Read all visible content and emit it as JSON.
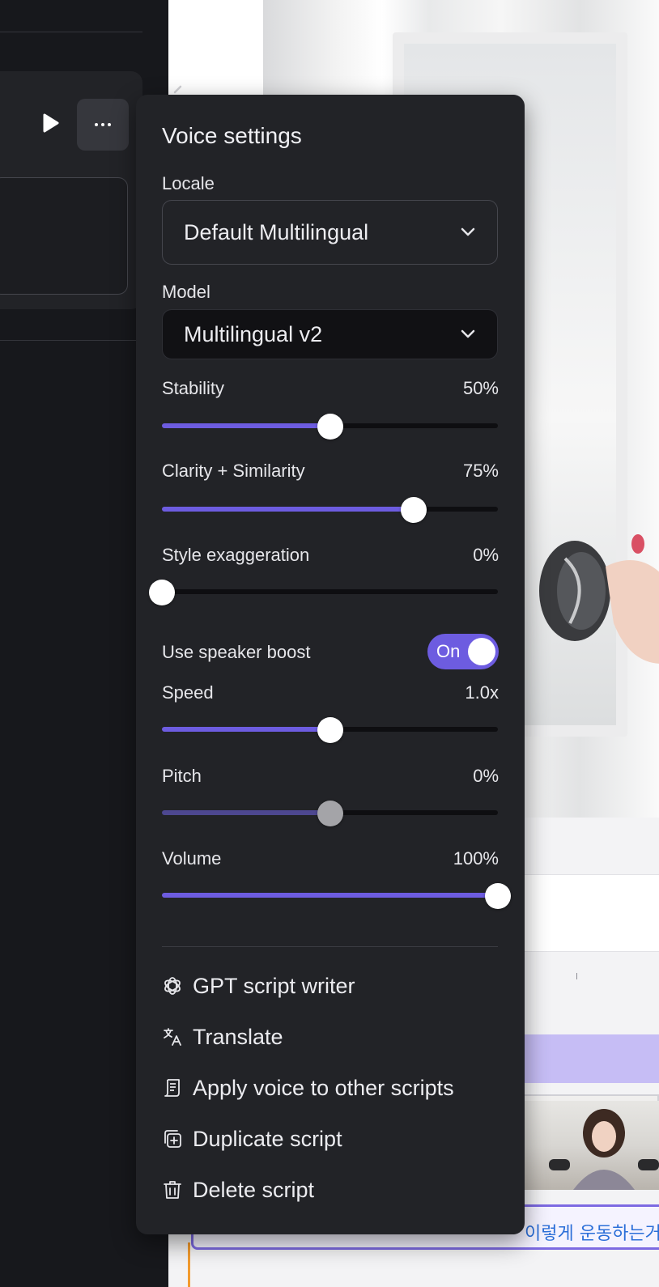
{
  "editor": {
    "caption_preview": "이렇게 운동하는거"
  },
  "voice_settings": {
    "title": "Voice settings",
    "locale": {
      "label": "Locale",
      "value": "Default Multilingual"
    },
    "model": {
      "label": "Model",
      "value": "Multilingual v2"
    },
    "sliders": {
      "stability": {
        "label": "Stability",
        "display": "50%",
        "fraction": 0.5
      },
      "clarity": {
        "label": "Clarity + Similarity",
        "display": "75%",
        "fraction": 0.75
      },
      "style": {
        "label": "Style exaggeration",
        "display": "0%",
        "fraction": 0.0
      },
      "speed": {
        "label": "Speed",
        "display": "1.0x",
        "fraction": 0.5
      },
      "pitch": {
        "label": "Pitch",
        "display": "0%",
        "fraction": 0.5
      },
      "volume": {
        "label": "Volume",
        "display": "100%",
        "fraction": 1.0
      }
    },
    "speaker_boost": {
      "label": "Use speaker boost",
      "state": "On"
    },
    "menu": {
      "gpt": "GPT script writer",
      "translate": "Translate",
      "apply": "Apply voice to other scripts",
      "duplicate": "Duplicate script",
      "delete": "Delete script"
    }
  },
  "colors": {
    "accent": "#6d5ce0",
    "panel": "#222327",
    "background": "#16171b"
  },
  "icons": [
    "play-icon",
    "more-icon",
    "chevron-down-icon",
    "openai-icon",
    "translate-icon",
    "scroll-icon",
    "duplicate-icon",
    "trash-icon"
  ]
}
